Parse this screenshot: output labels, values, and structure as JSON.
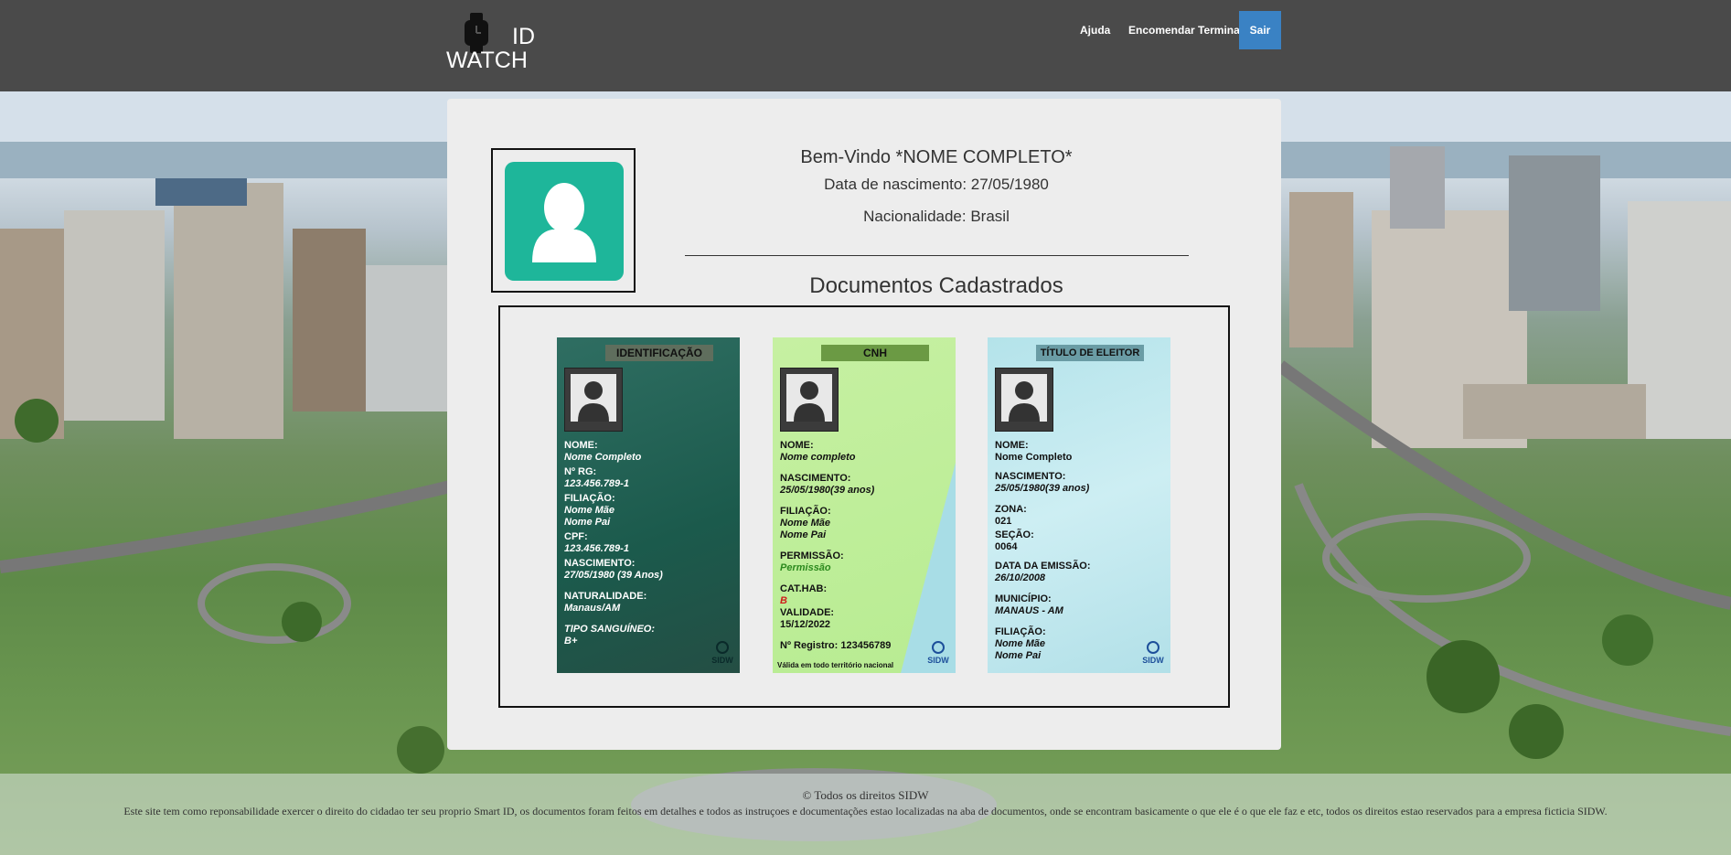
{
  "header": {
    "logo_id": "ID",
    "logo_watch": "WATCH",
    "nav_help": "Ajuda",
    "nav_order": "Encomendar Terminal",
    "exit_label": "Sair"
  },
  "profile": {
    "welcome": "Bem-Vindo *NOME COMPLETO*",
    "birth": "Data de nascimento: 27/05/1980",
    "nationality": "Nacionalidade: Brasil"
  },
  "documents": {
    "heading": "Documentos Cadastrados",
    "rg": {
      "title": "IDENTIFICAÇÃO",
      "fields": [
        {
          "label": "NOME:",
          "value": "Nome Completo"
        },
        {
          "label": "Nº RG:",
          "value": "123.456.789-1"
        },
        {
          "label": "FILIAÇÃO:",
          "value": "Nome Mãe",
          "value2": "Nome Pai"
        },
        {
          "label": "CPF:",
          "value": "123.456.789-1"
        },
        {
          "label": "NASCIMENTO:",
          "value": "27/05/1980 (39 Anos)"
        },
        {
          "label": "NATURALIDADE:",
          "value": "Manaus/AM"
        },
        {
          "label": "TIPO SANGUÍNEO:",
          "value": "B+"
        }
      ],
      "badge": "SIDW"
    },
    "cnh": {
      "title": "CNH",
      "fields": [
        {
          "label": "NOME:",
          "value": "Nome completo"
        },
        {
          "label": "NASCIMENTO:",
          "value": "25/05/1980(39 anos)"
        },
        {
          "label": "FILIAÇÃO:",
          "value": "Nome Mãe",
          "value2": "Nome Pai"
        },
        {
          "label": "PERMISSÃO:",
          "value": "Permissão"
        },
        {
          "label": "CAT.HAB:",
          "value": "B"
        },
        {
          "label": "VALIDADE:",
          "value": "15/12/2022"
        },
        {
          "label": "Nº Registro: 123456789",
          "value": ""
        }
      ],
      "note": "Válida em todo território nacional",
      "badge": "SIDW"
    },
    "titulo": {
      "title": "TÍTULO DE ELEITOR",
      "fields": [
        {
          "label": "NOME:",
          "value": "Nome Completo"
        },
        {
          "label": "NASCIMENTO:",
          "value": "25/05/1980(39 anos)"
        },
        {
          "label": "ZONA:",
          "value": "021"
        },
        {
          "label": "SEÇÃO:",
          "value": "0064"
        },
        {
          "label": "DATA DA EMISSÃO:",
          "value": "26/10/2008"
        },
        {
          "label": "MUNICÍPIO:",
          "value": "MANAUS - AM"
        },
        {
          "label": "FILIAÇÃO:",
          "value": "Nome Mãe",
          "value2": "Nome Pai"
        }
      ],
      "badge": "SIDW"
    }
  },
  "footer": {
    "copyright": "© Todos os direitos SIDW",
    "about": "Este site tem como reponsabilidade exercer o direito do cidadao ter seu proprio Smart ID, os documentos foram feitos em detalhes e todos as instruçoes e documentações estao localizadas na aba de documentos, onde se encontram basicamente o que ele é o que ele faz e etc, todos os direitos estao reservados para a empresa ficticia SIDW."
  },
  "colors": {
    "header_bg": "#4a4a4a",
    "exit_button": "#3a82c4",
    "avatar_tile": "#1eb69a",
    "card_bg": "#ededed"
  },
  "icons": {
    "logo": "smartwatch-icon",
    "avatar": "user-icon",
    "doc_photo": "user-silhouette-icon",
    "badge": "globe-icon"
  }
}
